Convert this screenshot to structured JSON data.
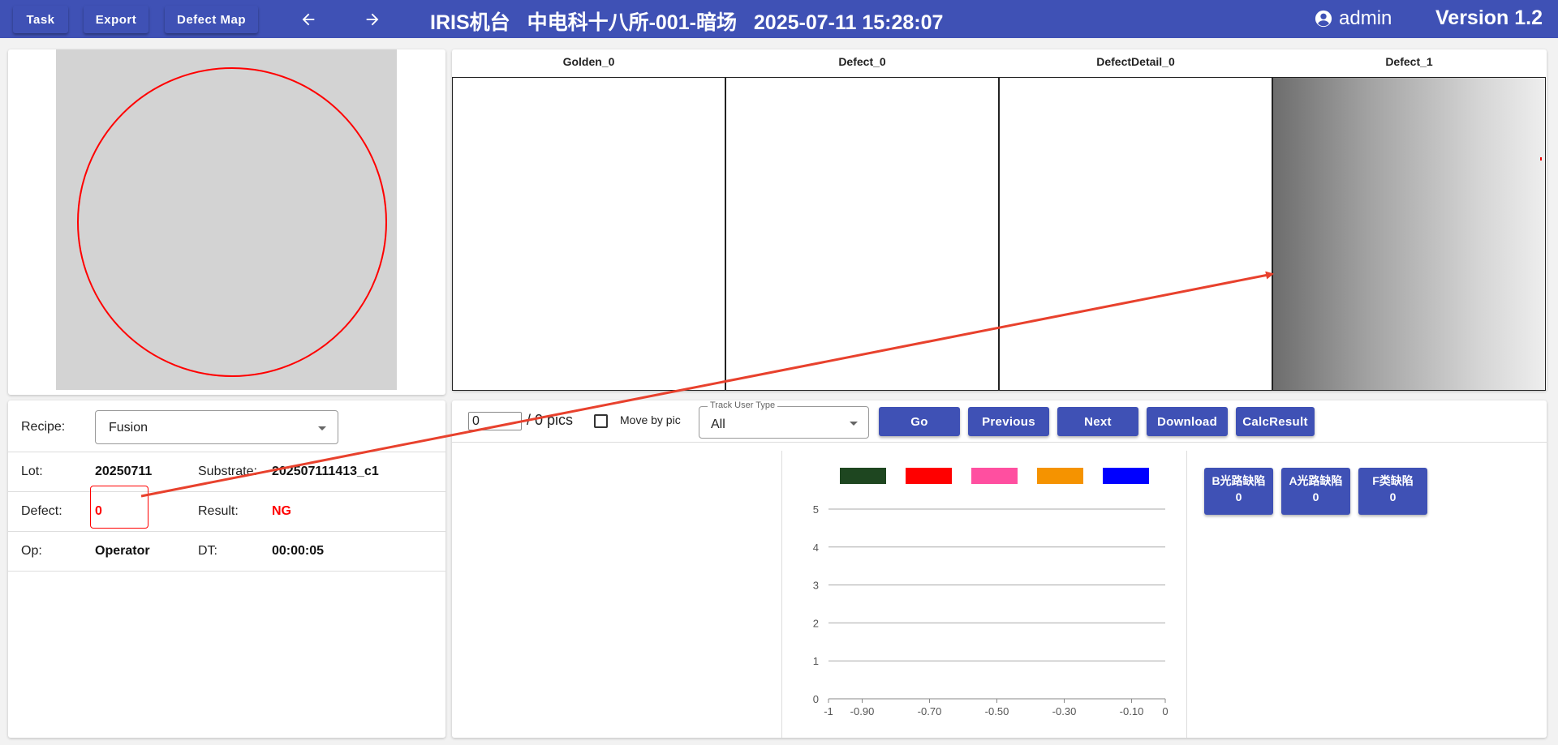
{
  "topbar": {
    "buttons": [
      "Task",
      "Export",
      "Defect Map"
    ],
    "title_parts": [
      "IRIS机台",
      "中电科十八所-001-暗场",
      "2025-07-11 15:28:07"
    ],
    "user": "admin",
    "version": "Version 1.2"
  },
  "images": {
    "headers": [
      "Golden_0",
      "Defect_0",
      "DefectDetail_0",
      "Defect_1"
    ]
  },
  "info": {
    "recipe_label": "Recipe:",
    "recipe_value": "Fusion",
    "lot_label": "Lot:",
    "lot_value": "20250711",
    "substrate_label": "Substrate:",
    "substrate_value": "202507111413_c1",
    "defect_label": "Defect:",
    "defect_value": "0",
    "result_label": "Result:",
    "result_value": "NG",
    "op_label": "Op:",
    "op_value": "Operator",
    "dt_label": "DT:",
    "dt_value": "00:00:05"
  },
  "controls": {
    "page_value": "0",
    "pics_label": "/ 0 pics",
    "move_by_pic": "Move by pic",
    "track_legend": "Track User Type",
    "track_value": "All",
    "buttons": [
      "Go",
      "Previous",
      "Next",
      "Download",
      "CalcResult"
    ]
  },
  "categories": [
    {
      "name": "B光路缺陷",
      "count": "0"
    },
    {
      "name": "A光路缺陷",
      "count": "0"
    },
    {
      "name": "F类缺陷",
      "count": "0"
    }
  ],
  "chart_data": {
    "type": "bar",
    "series": [
      {
        "color": "#1e4620",
        "values": []
      },
      {
        "color": "#ff0000",
        "values": []
      },
      {
        "color": "#ff4fa0",
        "values": []
      },
      {
        "color": "#f59300",
        "values": []
      },
      {
        "color": "#0000ff",
        "values": []
      }
    ],
    "ylim": [
      0,
      5
    ],
    "yticks": [
      "0",
      "1",
      "2",
      "3",
      "4",
      "5"
    ],
    "xlim": [
      -1,
      0
    ],
    "xticks": [
      "-1",
      "-0.90",
      "-0.70",
      "-0.50",
      "-0.30",
      "-0.10",
      "0"
    ],
    "xtick_values": [
      -1,
      -0.9,
      -0.7,
      -0.5,
      -0.3,
      -0.1,
      0
    ],
    "grid": true,
    "legend": "top"
  },
  "colors": {
    "primary": "#3f51b5",
    "alert": "#ff0000",
    "annotation": "#e8412d"
  }
}
